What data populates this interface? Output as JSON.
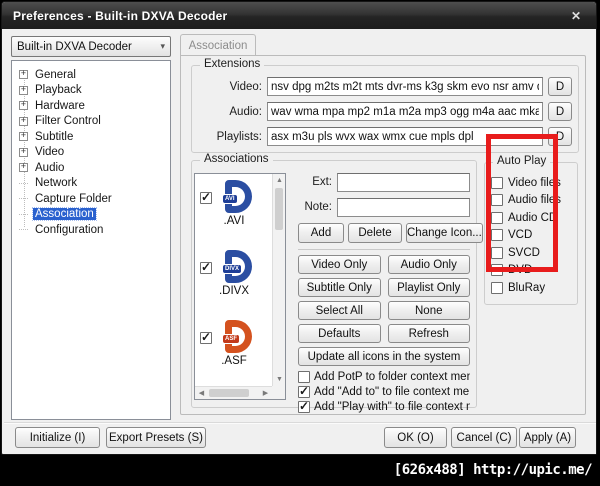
{
  "window": {
    "title": "Preferences - Built-in DXVA Decoder",
    "close_icon": "✕"
  },
  "icons": {
    "chevron_down": "▾",
    "arrow_up": "▲",
    "arrow_down": "▼",
    "arrow_left": "◀",
    "arrow_right": "▶",
    "expander_plus": "+",
    "check": "✓"
  },
  "sidebar": {
    "preset_selector": {
      "value": "Built-in DXVA Decoder"
    },
    "tree": [
      {
        "label": "General",
        "expandable": true,
        "selected": false
      },
      {
        "label": "Playback",
        "expandable": true,
        "selected": false
      },
      {
        "label": "Hardware",
        "expandable": true,
        "selected": false
      },
      {
        "label": "Filter Control",
        "expandable": true,
        "selected": false
      },
      {
        "label": "Subtitle",
        "expandable": true,
        "selected": false
      },
      {
        "label": "Video",
        "expandable": true,
        "selected": false
      },
      {
        "label": "Audio",
        "expandable": true,
        "selected": false
      },
      {
        "label": "Network",
        "expandable": false,
        "selected": false
      },
      {
        "label": "Capture Folder",
        "expandable": false,
        "selected": false
      },
      {
        "label": "Association",
        "expandable": false,
        "selected": true
      },
      {
        "label": "Configuration",
        "expandable": false,
        "selected": false
      }
    ]
  },
  "tab": {
    "label": "Association"
  },
  "extensions": {
    "legend": "Extensions",
    "rows": [
      {
        "label": "Video:",
        "value": "nsv dpg m2ts m2t mts dvr-ms k3g skm evo nsr amv divx webm",
        "button": "D"
      },
      {
        "label": "Audio:",
        "value": "wav wma mpa mp2 m1a m2a mp3 ogg m4a aac mka ra flac ape",
        "button": "D"
      },
      {
        "label": "Playlists:",
        "value": "asx m3u pls wvx wax wmx cue mpls dpl",
        "button": "D"
      }
    ]
  },
  "associations": {
    "legend": "Associations",
    "files": [
      {
        "ext": ".AVI",
        "badge": "AVI",
        "checked": true,
        "icon_color": "#2b4ea2",
        "badge_color": "#1d3d96"
      },
      {
        "ext": ".DIVX",
        "badge": "DIVX",
        "checked": true,
        "icon_color": "#2b4ea2",
        "badge_color": "#1d3d96"
      },
      {
        "ext": ".ASF",
        "badge": "ASF",
        "checked": true,
        "icon_color": "#d4521f",
        "badge_color": "#c2391a"
      }
    ],
    "fields": {
      "ext_label": "Ext:",
      "ext_value": "",
      "note_label": "Note:",
      "note_value": ""
    },
    "edit_buttons": [
      "Add",
      "Delete",
      "Change Icon..."
    ],
    "select_buttons": [
      "Video Only",
      "Audio Only",
      "Subtitle Only",
      "Playlist Only",
      "Select All",
      "None",
      "Defaults",
      "Refresh"
    ],
    "update_button": "Update all icons in the system",
    "context_checkboxes": [
      {
        "label": "Add PotP to folder context menu",
        "checked": false
      },
      {
        "label": "Add \"Add to\" to file context menu",
        "checked": true
      },
      {
        "label": "Add \"Play with\" to file context menu",
        "checked": true
      }
    ]
  },
  "autoplay": {
    "legend": "Auto Play",
    "items": [
      {
        "label": "Video files",
        "checked": false
      },
      {
        "label": "Audio files",
        "checked": false
      },
      {
        "label": "Audio CD",
        "checked": false
      },
      {
        "label": "VCD",
        "checked": false
      },
      {
        "label": "SVCD",
        "checked": false
      },
      {
        "label": "DVD",
        "checked": false
      },
      {
        "label": "BluRay",
        "checked": false
      }
    ]
  },
  "annotation": {
    "color": "#e81c1c"
  },
  "footer": {
    "initialize": "Initialize (I)",
    "export_presets": "Export Presets (S)",
    "ok": "OK (O)",
    "cancel": "Cancel (C)",
    "apply": "Apply (A)"
  },
  "watermark": "[626x488] http://upic.me/"
}
